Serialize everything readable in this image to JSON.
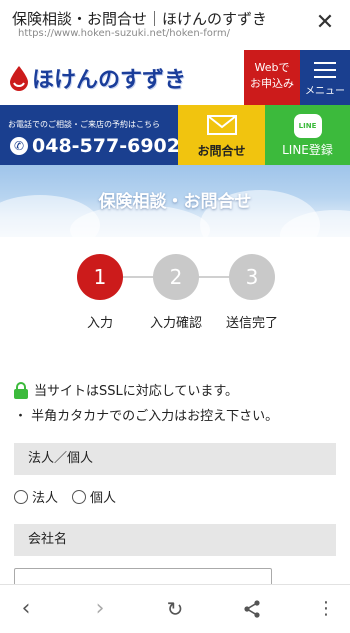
{
  "browser": {
    "title": "保険相談・お問合せ｜ほけんのすずき",
    "url": "https://www.hoken-suzuki.net/hoken-form/",
    "close_icon": "close-icon"
  },
  "header": {
    "logo_text": "ほけんのすずき",
    "web_line1": "Webで",
    "web_line2": "お申込み",
    "menu_label": "メニュー"
  },
  "contact": {
    "phone_caption": "お電話でのご相談・ご来店の予約はこちら",
    "phone_number": "048-577-6902",
    "inquiry_label": "お問合せ",
    "line_icon_text": "LINE",
    "line_label": "LINE登録"
  },
  "banner": {
    "title": "保険相談・お問合せ"
  },
  "steps": [
    {
      "number": "1",
      "label": "入力",
      "active": true
    },
    {
      "number": "2",
      "label": "入力確認",
      "active": false
    },
    {
      "number": "3",
      "label": "送信完了",
      "active": false
    }
  ],
  "notes": {
    "ssl": "当サイトはSSLに対応しています。",
    "kana": "・ 半角カタカナでのご入力はお控え下さい。"
  },
  "form": {
    "type_header": "法人／個人",
    "option_corp": "法人",
    "option_indiv": "個人",
    "company_header": "会社名",
    "company_value": ""
  },
  "colors": {
    "red": "#cc1b1b",
    "navy": "#1a3f8f",
    "yellow": "#f1c40f",
    "green": "#3cba3c"
  }
}
